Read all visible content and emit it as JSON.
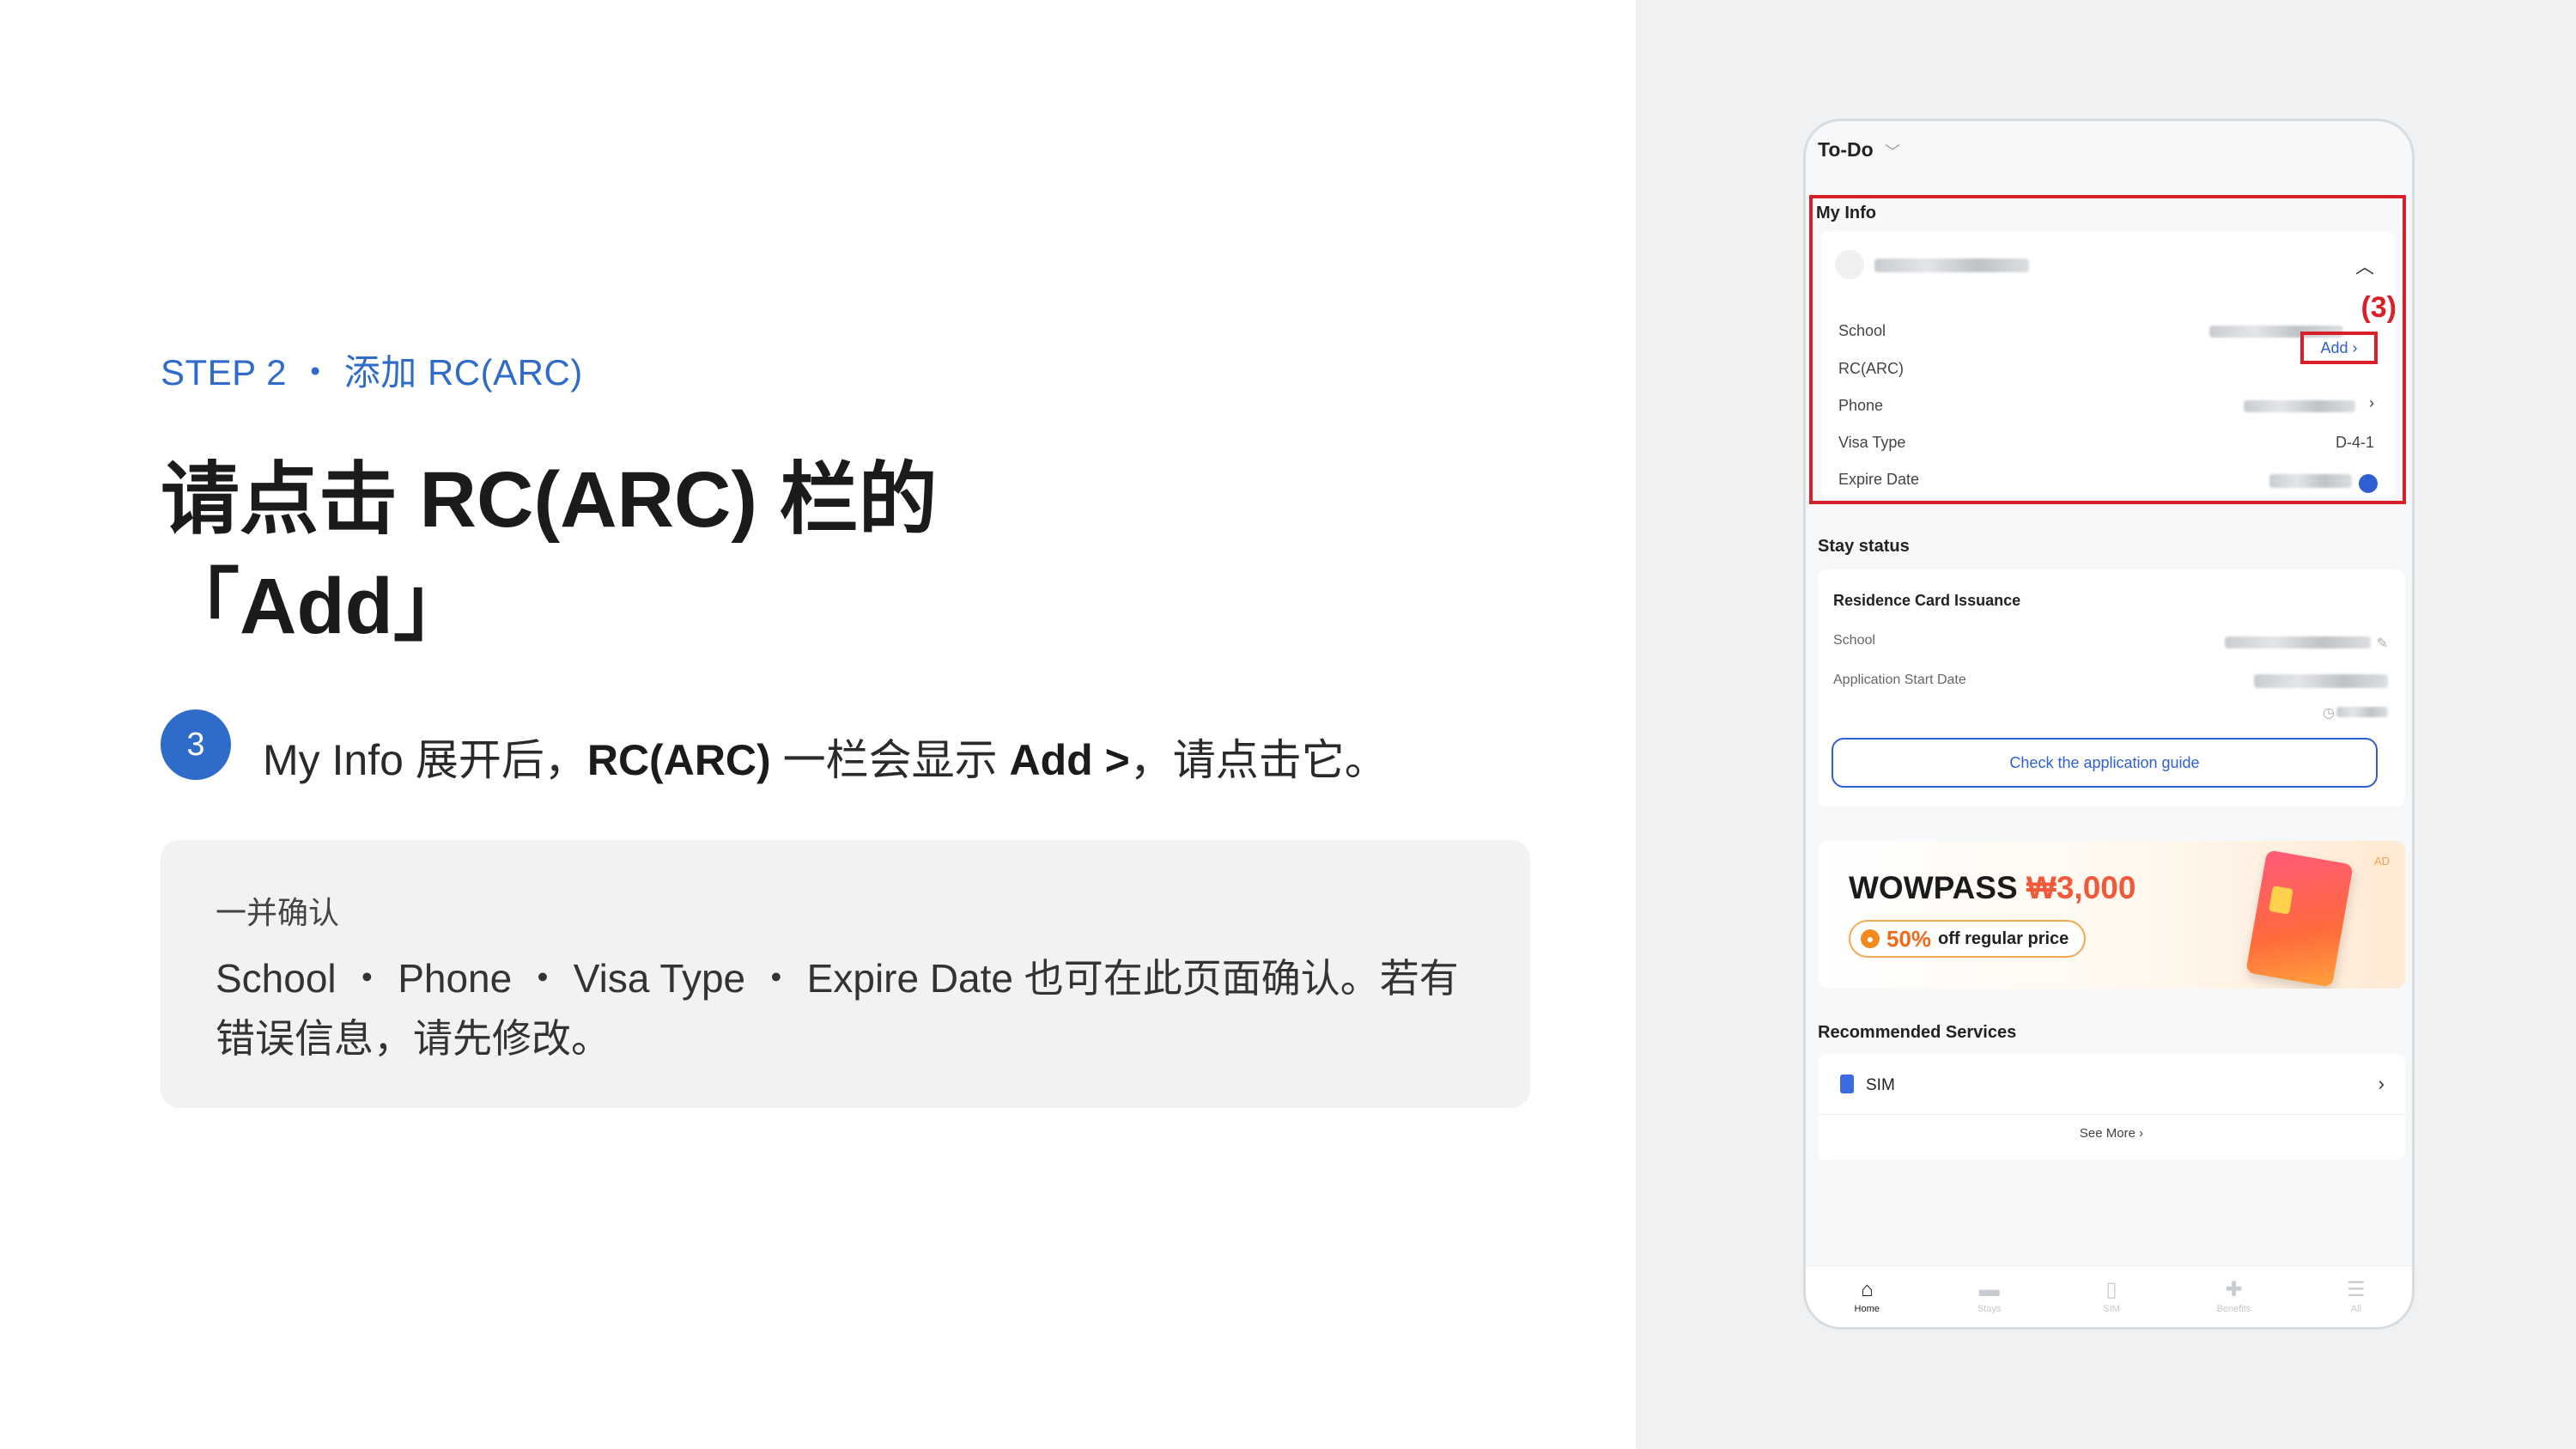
{
  "left": {
    "step": "STEP 2 ・ 添加 RC(ARC)",
    "title_line1": "请点击 RC(ARC) 栏的",
    "title_line2": "「Add」",
    "badge": "3",
    "instruction": {
      "part1": "My Info 展开后，",
      "part2": "RC(ARC)",
      "part3": " 一栏会显示 ",
      "part4": "Add >",
      "part5": "，请点击它。"
    },
    "note": {
      "title": "一并确认",
      "body": "School ・ Phone ・ Visa Type ・ Expire Date 也可在此页面确认。若有错误信息，请先修改。"
    }
  },
  "phone": {
    "todo": "To-Do",
    "my_info": {
      "label": "My Info",
      "callout": "(3)",
      "rows": [
        {
          "label": "School"
        },
        {
          "label": "RC(ARC)",
          "action": "Add"
        },
        {
          "label": "Phone"
        },
        {
          "label": "Visa Type",
          "value": "D-4-1"
        },
        {
          "label": "Expire Date"
        }
      ]
    },
    "stay_status": {
      "label": "Stay status",
      "card_title": "Residence Card Issuance",
      "school": "School",
      "start_date": "Application Start Date",
      "guide_button": "Check the application guide"
    },
    "banner": {
      "brand": "WOWPASS",
      "price": "₩3,000",
      "percent": "50%",
      "promo": "off regular price",
      "ad": "AD"
    },
    "recommended": {
      "label": "Recommended Services",
      "item": "SIM",
      "see_more": "See More"
    },
    "tabs": [
      {
        "label": "Home",
        "icon": "home-icon"
      },
      {
        "label": "Stays",
        "icon": "bed-icon"
      },
      {
        "label": "SIM",
        "icon": "sim-icon"
      },
      {
        "label": "Benefits",
        "icon": "gift-icon"
      },
      {
        "label": "All",
        "icon": "menu-icon"
      }
    ]
  },
  "colors": {
    "accent": "#2f6bc9",
    "highlight_red": "#d9202a",
    "link_blue": "#2f5fd0",
    "promo_orange": "#f05a3a"
  }
}
